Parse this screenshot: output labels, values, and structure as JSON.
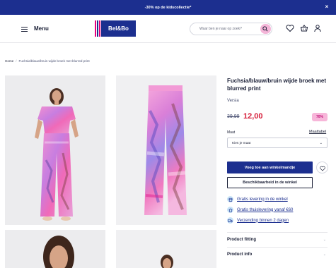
{
  "promo": {
    "text": "-30% op de kidscollectie*"
  },
  "header": {
    "menu_label": "Menu",
    "logo_text": "Bel&Bo",
    "search_placeholder": "Waar ben je naar op zoek?",
    "icons": [
      "heart-icon",
      "basket-icon",
      "user-icon"
    ]
  },
  "breadcrumb": {
    "home": "Home",
    "separator": "/",
    "current": "Fuchsia/blauw/bruin wijde broek met blurred print"
  },
  "product": {
    "title": "Fuchsia/blauw/bruin wijde broek met blurred print",
    "brand": "Versia",
    "old_price": "39,99",
    "new_price": "12,00",
    "discount_badge": "70%",
    "size_label": "Maat",
    "size_chart_link": "Maattabel",
    "size_select_value": "Kies je maat",
    "add_to_cart_label": "Voeg toe aan winkelmandje",
    "availability_label": "Beschikbaarheid in de winkel",
    "usps": [
      {
        "icon": "store-icon",
        "text": "Gratis levering in de winkel"
      },
      {
        "icon": "home-delivery-icon",
        "text": "Gratis thuislevering vanaf €60"
      },
      {
        "icon": "delivery-truck-icon",
        "text": "Verzending binnen 2 dagen"
      }
    ],
    "accordions": [
      {
        "label": "Product fitting"
      },
      {
        "label": "Product info"
      }
    ]
  },
  "colors": {
    "brand_blue": "#1c2f8f",
    "price_red": "#d61e3a",
    "badge_pink": "#f7b6d9",
    "search_pink": "#f4b5d8"
  }
}
